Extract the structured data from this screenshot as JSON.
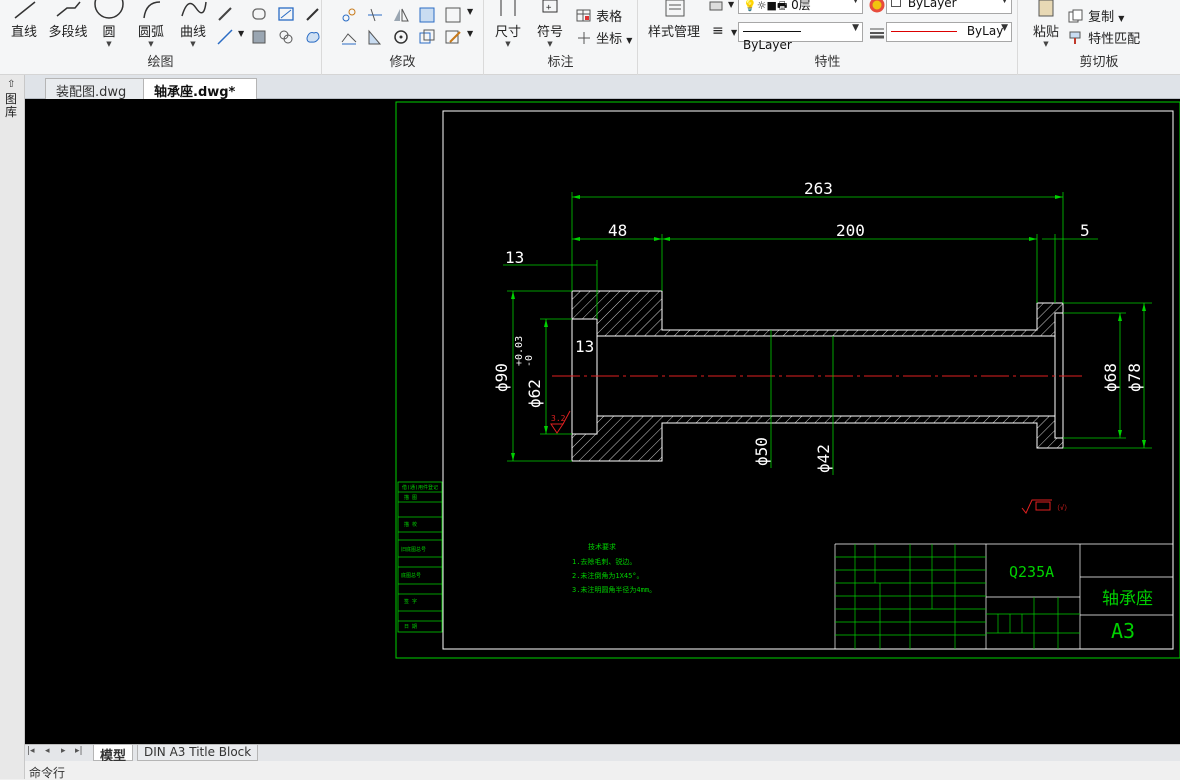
{
  "ribbon": {
    "draw": {
      "label": "绘图",
      "buttons": [
        {
          "name": "line-button",
          "label": "直线"
        },
        {
          "name": "polyline-button",
          "label": "多段线"
        },
        {
          "name": "circle-button",
          "label": "圆"
        },
        {
          "name": "arc-button",
          "label": "圆弧"
        },
        {
          "name": "curve-button",
          "label": "曲线"
        }
      ]
    },
    "modify": {
      "label": "修改"
    },
    "annotation": {
      "label": "标注",
      "dimension": "尺寸",
      "symbol": "符号",
      "table": "表格",
      "coordinate": "坐标"
    },
    "properties": {
      "label": "特性",
      "style_manager": "样式管理",
      "layer_value": "0层",
      "color_value": "ByLayer",
      "linetype_value": "ByLayer",
      "lineweight_value": "ByLay"
    },
    "clipboard": {
      "label": "剪切板",
      "paste": "粘贴",
      "copy": "复制",
      "match_props": "特性匹配"
    }
  },
  "file_tabs": [
    {
      "label": "装配图.dwg",
      "active": false
    },
    {
      "label": "轴承座.dwg*",
      "active": true,
      "close": "×"
    }
  ],
  "left_panel": {
    "label": "图库"
  },
  "drawing": {
    "dims": {
      "overall_length": "263",
      "left_section": "48",
      "middle_section": "200",
      "right_gap": "5",
      "left_wall": "13",
      "bore_depth": "13",
      "dia_90": "ϕ90",
      "dia_62": "ϕ62",
      "tol_upper": "+0.03",
      "tol_lower": "-0",
      "dia_50": "ϕ50",
      "dia_42": "ϕ42",
      "dia_68": "ϕ68",
      "dia_78": "ϕ78",
      "roughness_value": "3.2",
      "general_roughness": "（√）"
    },
    "notes": {
      "heading": "技术要求",
      "lines": [
        "1.去除毛刺、锐边。",
        "2.未注倒角为1X45°。",
        "3.未注明圆角半径为4mm。"
      ]
    },
    "title_block": {
      "material": "Q235A",
      "part_name": "轴承座",
      "sheet_size": "A3"
    },
    "left_column": [
      "借(通)用件登记",
      "描 图",
      "描 校",
      "旧底图总号",
      "底图总号",
      "签 字",
      "日 期"
    ]
  },
  "layout_tabs": [
    {
      "label": "模型",
      "active": true
    },
    {
      "label": "DIN A3 Title Block",
      "active": false
    }
  ],
  "command_line": {
    "prompt": "命令行"
  }
}
